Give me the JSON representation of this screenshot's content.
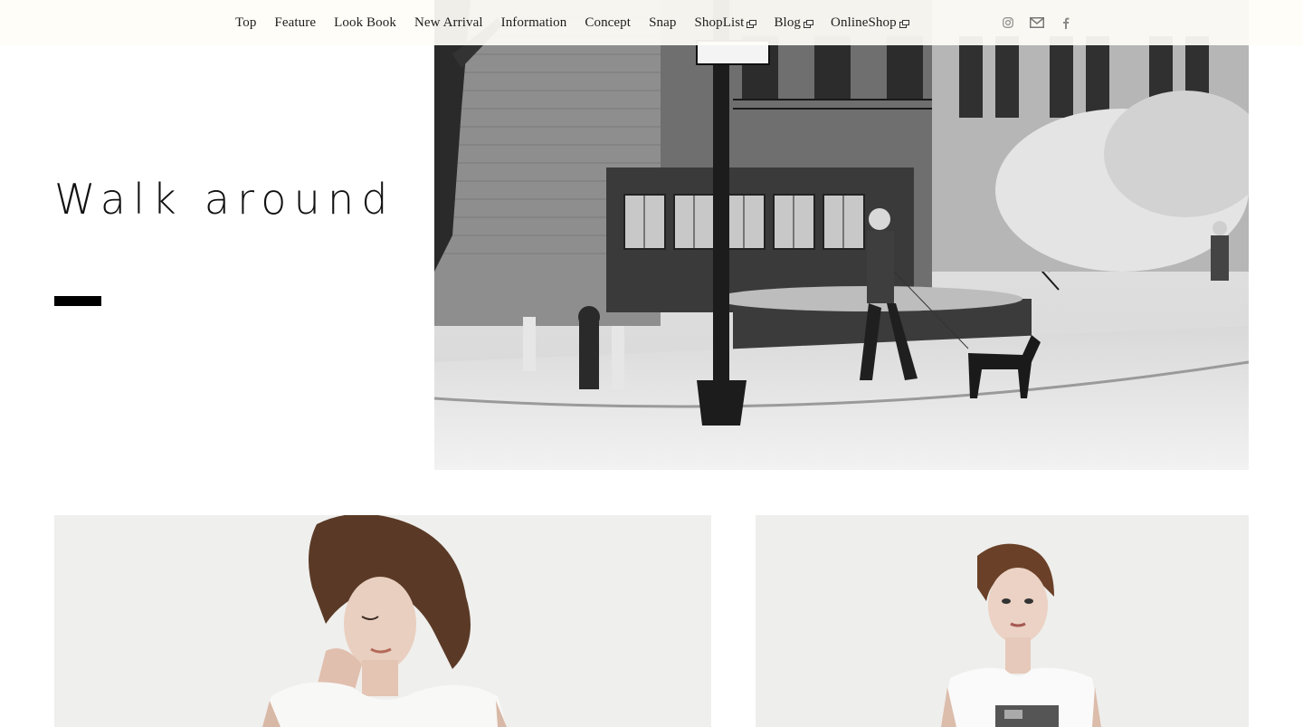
{
  "nav": {
    "items": [
      {
        "label": "Top",
        "external": false
      },
      {
        "label": "Feature",
        "external": false
      },
      {
        "label": "Look Book",
        "external": false
      },
      {
        "label": "New Arrival",
        "external": false
      },
      {
        "label": "Information",
        "external": false
      },
      {
        "label": "Concept",
        "external": false
      },
      {
        "label": "Snap",
        "external": false
      },
      {
        "label": "ShopList",
        "external": true
      },
      {
        "label": "Blog",
        "external": true
      },
      {
        "label": "OnlineShop",
        "external": true
      }
    ],
    "external_icon": "external-window-icon"
  },
  "social": {
    "icons": [
      "instagram-icon",
      "mail-icon",
      "facebook-icon"
    ]
  },
  "hero": {
    "headline": "Walk around",
    "photo": "street-corner-photo"
  },
  "gallery": {
    "left_photo": "model-looking-down-photo",
    "right_photo": "model-graphic-tee-photo"
  },
  "colors": {
    "topbar_bg": "#fffdf6",
    "text": "#1e1e1e",
    "accent_bar": "#000000",
    "social_icon": "#8a8a8a"
  }
}
